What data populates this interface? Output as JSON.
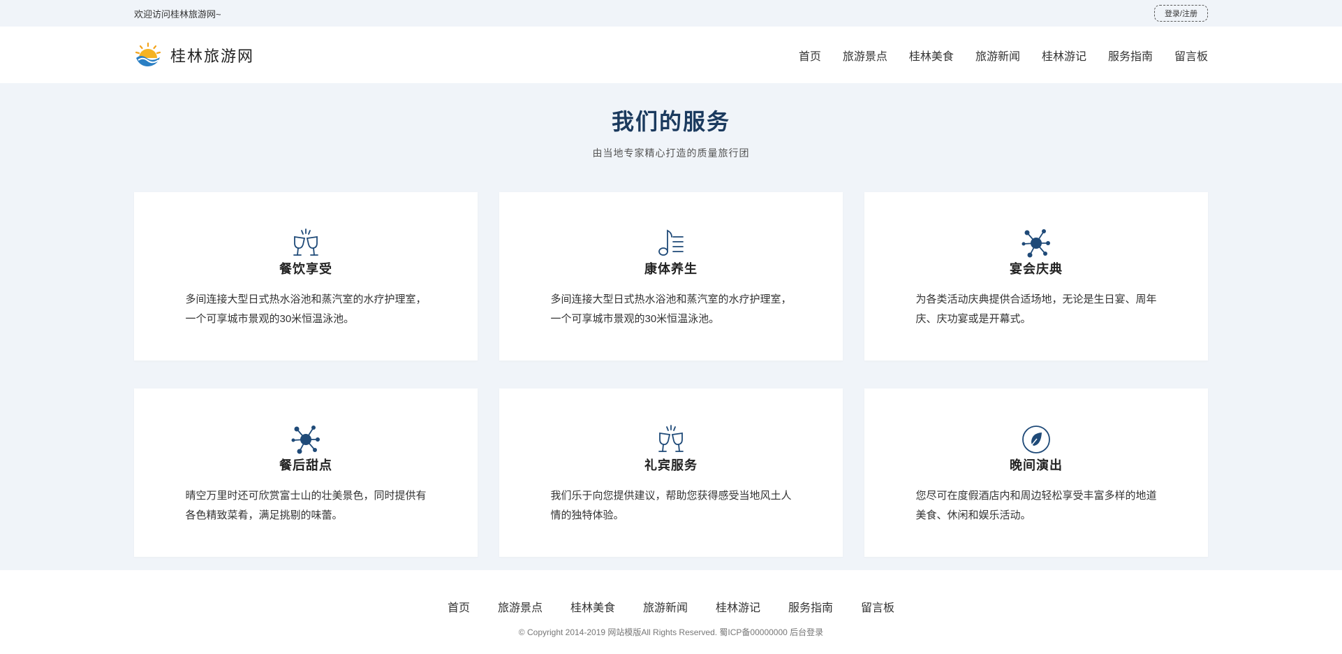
{
  "topbar": {
    "welcome": "欢迎访问桂林旅游网~",
    "login_label": "登录/注册"
  },
  "header": {
    "logo_text": "桂林旅游网",
    "nav": [
      "首页",
      "旅游景点",
      "桂林美食",
      "旅游新闻",
      "桂林游记",
      "服务指南",
      "留言板"
    ]
  },
  "services": {
    "title": "我们的服务",
    "subtitle": "由当地专家精心打造的质量旅行团",
    "cards": [
      {
        "icon": "wine-glasses-icon",
        "title": "餐饮享受",
        "desc": "多间连接大型日式热水浴池和蒸汽室的水疗护理室，一个可享城市景观的30米恒温泳池。"
      },
      {
        "icon": "music-note-icon",
        "title": "康体养生",
        "desc": "多间连接大型日式热水浴池和蒸汽室的水疗护理室，一个可享城市景观的30米恒温泳池。"
      },
      {
        "icon": "network-icon",
        "title": "宴会庆典",
        "desc": "为各类活动庆典提供合适场地，无论是生日宴、周年庆、庆功宴或是开幕式。"
      },
      {
        "icon": "network-icon",
        "title": "餐后甜点",
        "desc": "晴空万里时还可欣赏富士山的壮美景色，同时提供有各色精致菜肴，满足挑剔的味蕾。"
      },
      {
        "icon": "wine-glasses-icon",
        "title": "礼宾服务",
        "desc": "我们乐于向您提供建议，帮助您获得感受当地风土人情的独特体验。"
      },
      {
        "icon": "leaf-icon",
        "title": "晚间演出",
        "desc": "您尽可在度假酒店内和周边轻松享受丰富多样的地道美食、休闲和娱乐活动。"
      }
    ]
  },
  "footer": {
    "nav": [
      "首页",
      "旅游景点",
      "桂林美食",
      "旅游新闻",
      "桂林游记",
      "服务指南",
      "留言板"
    ],
    "copyright": "© Copyright 2014-2019 网站模版All Rights Reserved. 蜀ICP备00000000",
    "admin_link": "后台登录"
  },
  "colors": {
    "accent": "#1b3a5e",
    "icon": "#1f4a78",
    "background": "#f0f4f9"
  }
}
